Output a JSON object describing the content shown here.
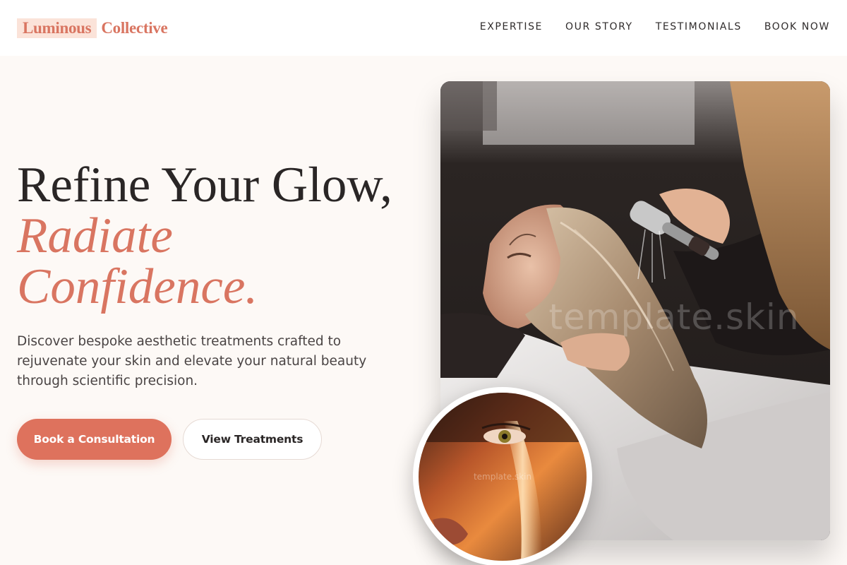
{
  "brand": {
    "part1": "Luminous",
    "part2": "Collective"
  },
  "nav": {
    "items": [
      "EXPERTISE",
      "OUR STORY",
      "TESTIMONIALS",
      "BOOK NOW"
    ]
  },
  "hero": {
    "headline_line1": "Refine Your Glow,",
    "headline_accent1": "Radiate",
    "headline_accent2": "Confidence.",
    "lead": "Discover bespoke aesthetic treatments crafted to rejuvenate your skin and elevate your natural beauty through scientific precision.",
    "primary_cta": "Book a Consultation",
    "secondary_cta": "View Treatments"
  },
  "images": {
    "main_watermark": "template.skin",
    "round_watermark": "template.skin"
  },
  "colors": {
    "accent": "#de725d",
    "brand_text": "#d97561",
    "brand_highlight": "#fbe3d9",
    "page_bg": "#fdf9f6",
    "ink": "#2a2626"
  }
}
